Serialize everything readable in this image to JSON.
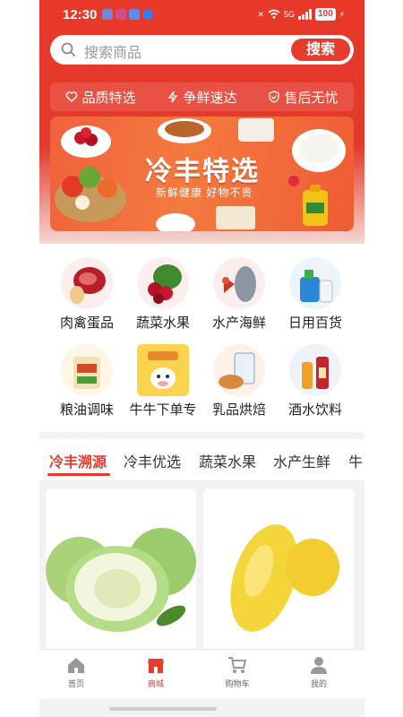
{
  "status": {
    "time": "12:30",
    "network": "5G",
    "battery": "100"
  },
  "search": {
    "placeholder": "搜索商品",
    "button": "搜索"
  },
  "features": [
    {
      "label": "品质特选",
      "icon": "heart-icon"
    },
    {
      "label": "争鲜速达",
      "icon": "lightning-icon"
    },
    {
      "label": "售后无忧",
      "icon": "shield-check-icon"
    }
  ],
  "banner": {
    "title": "冷丰特选",
    "subtitle": "新鲜健康  好物不贵"
  },
  "categories": [
    {
      "label": "肉禽蛋品",
      "icon": "meat-icon"
    },
    {
      "label": "蔬菜水果",
      "icon": "vegetables-fruit-icon"
    },
    {
      "label": "水产海鲜",
      "icon": "seafood-icon"
    },
    {
      "label": "日用百货",
      "icon": "daily-goods-icon"
    },
    {
      "label": "粮油调味",
      "icon": "rice-oil-icon"
    },
    {
      "label": "牛牛下单专",
      "icon": "cow-order-icon"
    },
    {
      "label": "乳品烘焙",
      "icon": "dairy-bakery-icon"
    },
    {
      "label": "酒水饮料",
      "icon": "drinks-icon"
    }
  ],
  "tabs": [
    "冷丰溯源",
    "冷丰优选",
    "蔬菜水果",
    "水产生鲜",
    "牛"
  ],
  "active_tab": "冷丰溯源",
  "nav": [
    {
      "label": "首页",
      "icon": "home-icon"
    },
    {
      "label": "商城",
      "icon": "shop-icon"
    },
    {
      "label": "购物车",
      "icon": "cart-icon"
    },
    {
      "label": "我的",
      "icon": "user-icon"
    }
  ],
  "active_nav": "商城",
  "colors": {
    "brand": "#e63b2d",
    "banner": "#f47a3e"
  }
}
